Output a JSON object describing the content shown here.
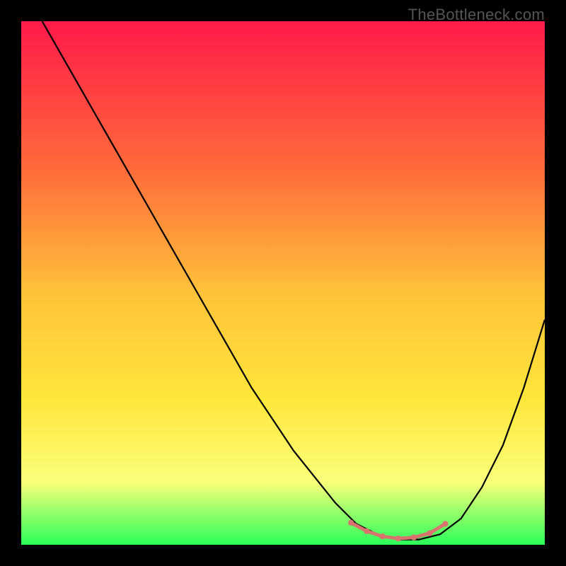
{
  "watermark": "TheBottleneck.com",
  "colors": {
    "top": "#ff1a4a",
    "mid_upper": "#ff6a3a",
    "mid": "#ffc23a",
    "mid_lower": "#ffe63a",
    "lower": "#faff7a",
    "bottom": "#2aff5a",
    "curve": "#000000",
    "marker": "#d9736f"
  },
  "chart_data": {
    "type": "line",
    "title": "",
    "xlabel": "",
    "ylabel": "",
    "xlim": [
      0,
      100
    ],
    "ylim": [
      0,
      100
    ],
    "series": [
      {
        "name": "bottleneck-curve",
        "x": [
          4,
          8,
          12,
          16,
          20,
          24,
          28,
          32,
          36,
          40,
          44,
          48,
          52,
          56,
          60,
          64,
          68,
          72,
          76,
          80,
          84,
          88,
          92,
          96,
          100
        ],
        "values": [
          100,
          93,
          86,
          79,
          72,
          65,
          58,
          51,
          44,
          37,
          30,
          24,
          18,
          13,
          8,
          4,
          2,
          1,
          1,
          2,
          5,
          11,
          19,
          30,
          43
        ]
      }
    ],
    "markers": {
      "name": "optimal-range",
      "x": [
        63,
        66,
        69,
        72,
        75,
        78,
        81
      ],
      "y": [
        4.2,
        2.6,
        1.6,
        1.2,
        1.4,
        2.2,
        4.0
      ]
    },
    "annotations": []
  }
}
